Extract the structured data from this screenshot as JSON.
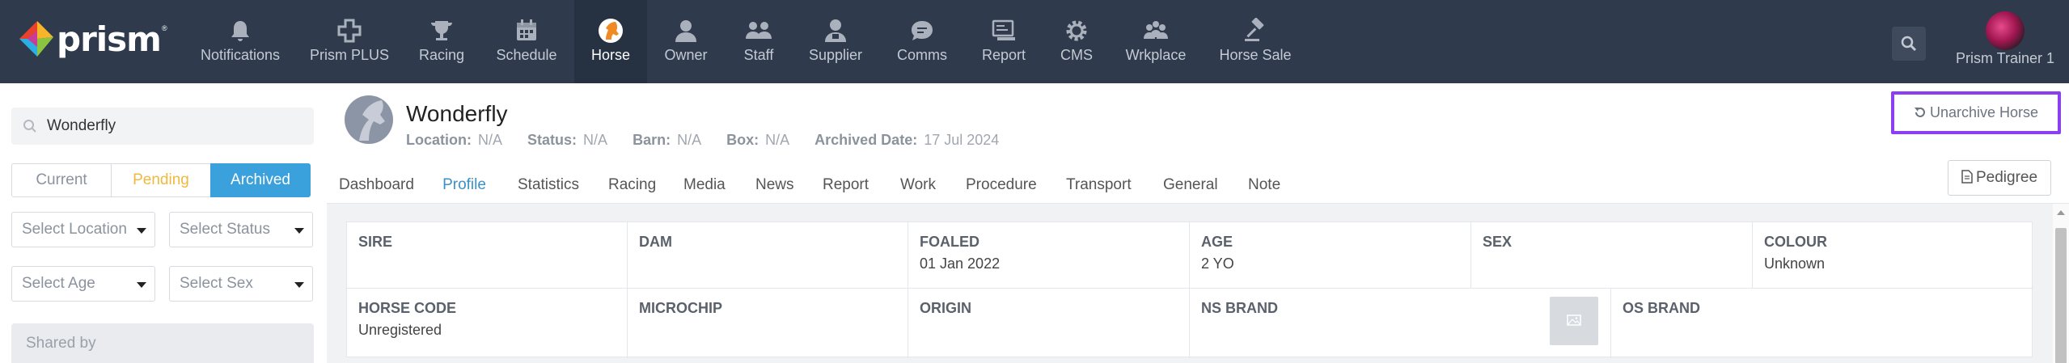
{
  "brand": {
    "name": "prism",
    "trademark": "®"
  },
  "nav": {
    "items": [
      {
        "label": "Notifications",
        "icon": "bell-icon"
      },
      {
        "label": "Prism PLUS",
        "icon": "plus-cross-icon"
      },
      {
        "label": "Racing",
        "icon": "trophy-icon"
      },
      {
        "label": "Schedule",
        "icon": "calendar-icon"
      },
      {
        "label": "Horse",
        "icon": "horse-head-icon"
      },
      {
        "label": "Owner",
        "icon": "person-icon"
      },
      {
        "label": "Staff",
        "icon": "group-icon"
      },
      {
        "label": "Supplier",
        "icon": "supplier-icon"
      },
      {
        "label": "Comms",
        "icon": "chat-bubble-icon"
      },
      {
        "label": "Report",
        "icon": "report-icon"
      },
      {
        "label": "CMS",
        "icon": "gear-icon"
      },
      {
        "label": "Wrkplace",
        "icon": "workplace-icon"
      },
      {
        "label": "Horse Sale",
        "icon": "gavel-icon"
      }
    ],
    "active": "Horse"
  },
  "user": {
    "name": "Prism Trainer 1"
  },
  "sidebar": {
    "search_value": "Wonderfly",
    "filters": {
      "current": "Current",
      "pending": "Pending",
      "archived": "Archived",
      "selected": "Archived"
    },
    "selects": {
      "location": "Select Location",
      "status": "Select Status",
      "age": "Select Age",
      "sex": "Select Sex"
    },
    "shared_by": "Shared by"
  },
  "horse": {
    "name": "Wonderfly",
    "meta": {
      "location_label": "Location:",
      "location": "N/A",
      "status_label": "Status:",
      "status": "N/A",
      "barn_label": "Barn:",
      "barn": "N/A",
      "box_label": "Box:",
      "box": "N/A",
      "archived_label": "Archived Date:",
      "archived": "17 Jul 2024"
    }
  },
  "actions": {
    "unarchive": "Unarchive Horse",
    "pedigree": "Pedigree"
  },
  "tabs": [
    "Dashboard",
    "Profile",
    "Statistics",
    "Racing",
    "Media",
    "News",
    "Report",
    "Work",
    "Procedure",
    "Transport",
    "General",
    "Note"
  ],
  "active_tab": "Profile",
  "profile": {
    "row1": [
      {
        "key": "SIRE",
        "value": ""
      },
      {
        "key": "DAM",
        "value": ""
      },
      {
        "key": "FOALED",
        "value": "01 Jan 2022"
      },
      {
        "key": "AGE",
        "value": "2 YO"
      },
      {
        "key": "SEX",
        "value": ""
      },
      {
        "key": "COLOUR",
        "value": "Unknown"
      }
    ],
    "row2": [
      {
        "key": "HORSE CODE",
        "value": "Unregistered"
      },
      {
        "key": "MICROCHIP",
        "value": ""
      },
      {
        "key": "ORIGIN",
        "value": ""
      },
      {
        "key": "NS BRAND",
        "value": ""
      },
      {
        "key": "OS BRAND",
        "value": ""
      }
    ]
  },
  "colors": {
    "nav_bg": "#2f3b4d",
    "accent": "#3aa1dc",
    "pending": "#f0b840",
    "highlight": "#8a3ff1"
  }
}
